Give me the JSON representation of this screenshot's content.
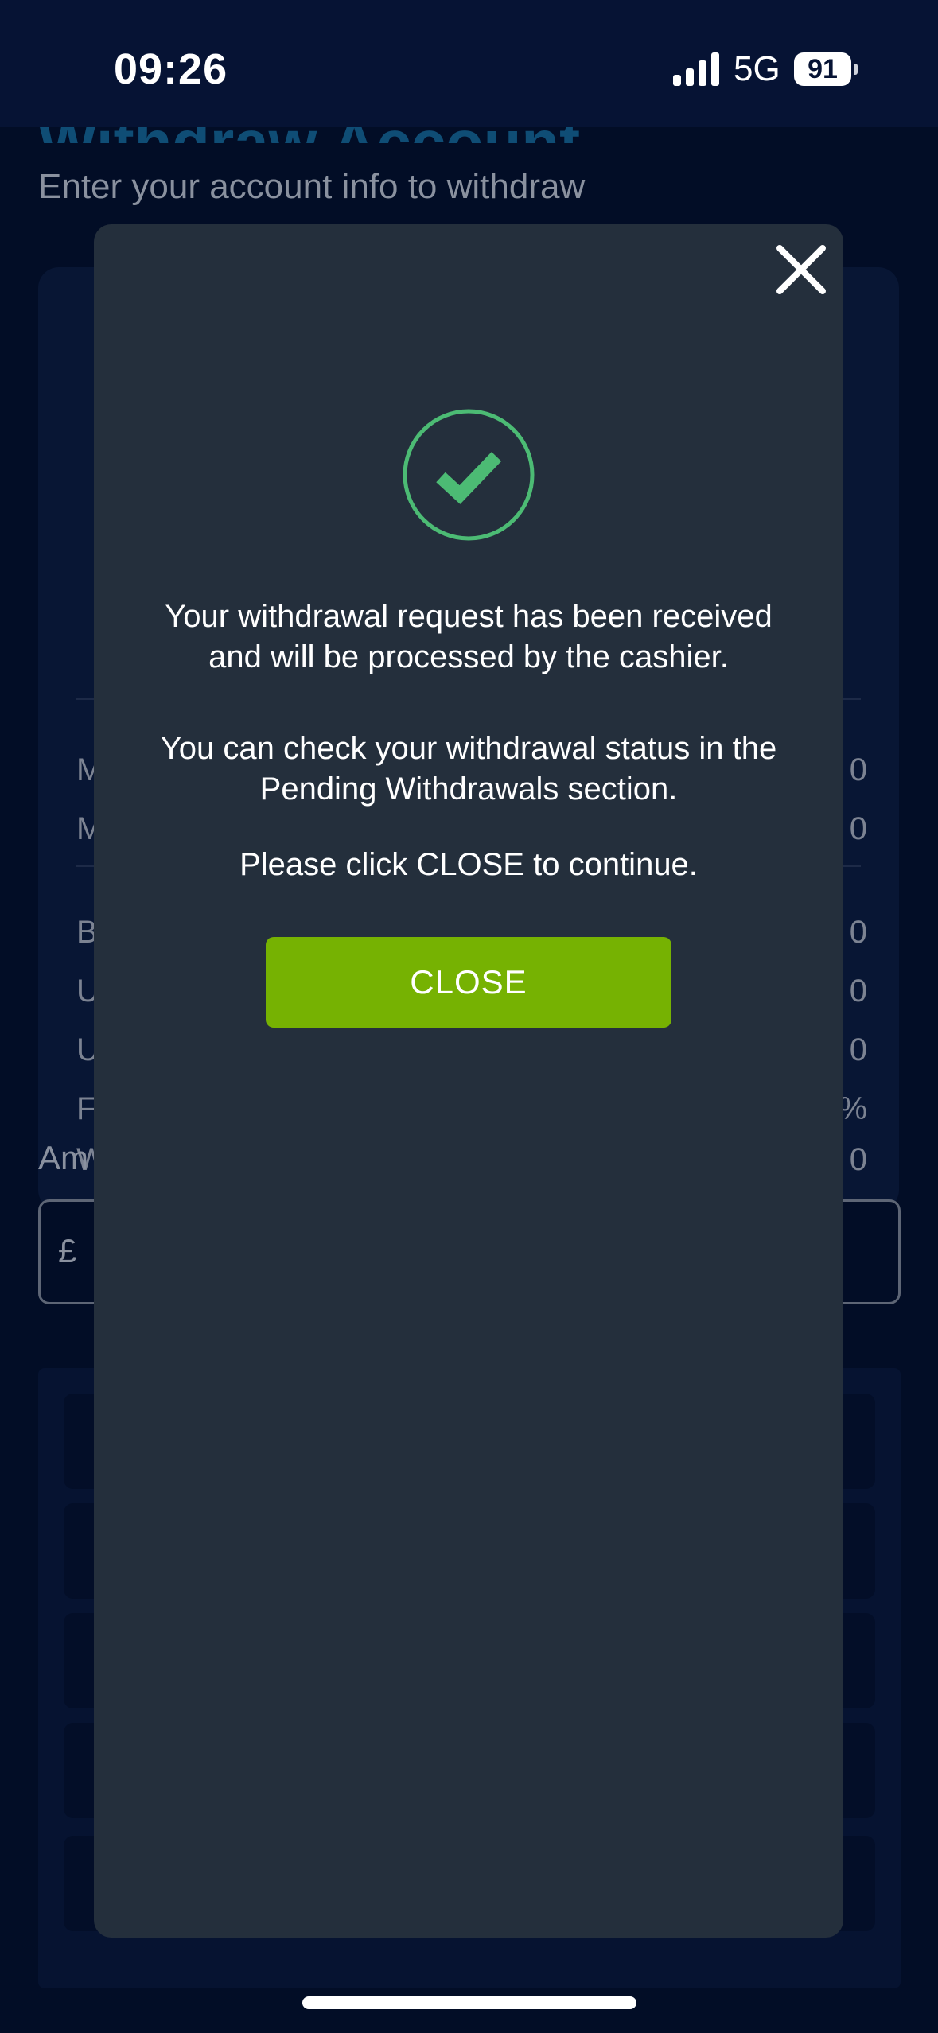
{
  "status_bar": {
    "time": "09:26",
    "network": "5G",
    "battery": "91"
  },
  "page": {
    "heading": "Withdraw Account",
    "subtitle": "Enter your account info to withdraw",
    "card_left_letters": [
      "M",
      "M",
      "B",
      "U",
      "U",
      "F",
      "W"
    ],
    "card_right_values": [
      "0",
      "0",
      "0",
      "0",
      "0",
      "%",
      "0"
    ],
    "amount_label": "Am",
    "currency_symbol": "£"
  },
  "modal": {
    "message_1": "Your withdrawal request has been received and will be processed by the cashier.",
    "message_2": "You can check your withdrawal status in the Pending Withdrawals section.",
    "message_3": "Please click CLOSE to continue.",
    "close_label": "CLOSE"
  },
  "colors": {
    "accent_green": "#76b202",
    "success_green": "#4cbb74",
    "modal_bg": "#242f3c",
    "page_bg": "#010b24"
  },
  "icons": {
    "close": "close-icon",
    "success": "check-circle-icon",
    "signal": "signal-bars-icon",
    "battery": "battery-icon"
  }
}
